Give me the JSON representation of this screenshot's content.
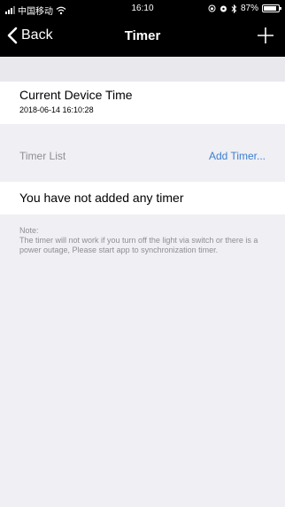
{
  "status_bar": {
    "carrier": "中国移动",
    "time": "16:10",
    "battery": "87%",
    "battery_level": 0.87
  },
  "nav": {
    "back_label": "Back",
    "title": "Timer"
  },
  "device_time": {
    "title": "Current Device Time",
    "value": "2018-06-14 16:10:28"
  },
  "timer_list": {
    "label": "Timer List",
    "add_label": "Add Timer...",
    "empty_text": "You have not added any timer"
  },
  "note": {
    "heading": "Note:",
    "body": "The timer will not work if you turn off the light via switch or there is a power outage, Please start app to synchronization timer."
  },
  "colors": {
    "link": "#3d7fd1",
    "background": "#efeff4",
    "nav_background": "#000000"
  },
  "icons": [
    "signal-icon",
    "wifi-icon",
    "back-chevron-icon",
    "add-icon",
    "battery-icon"
  ]
}
